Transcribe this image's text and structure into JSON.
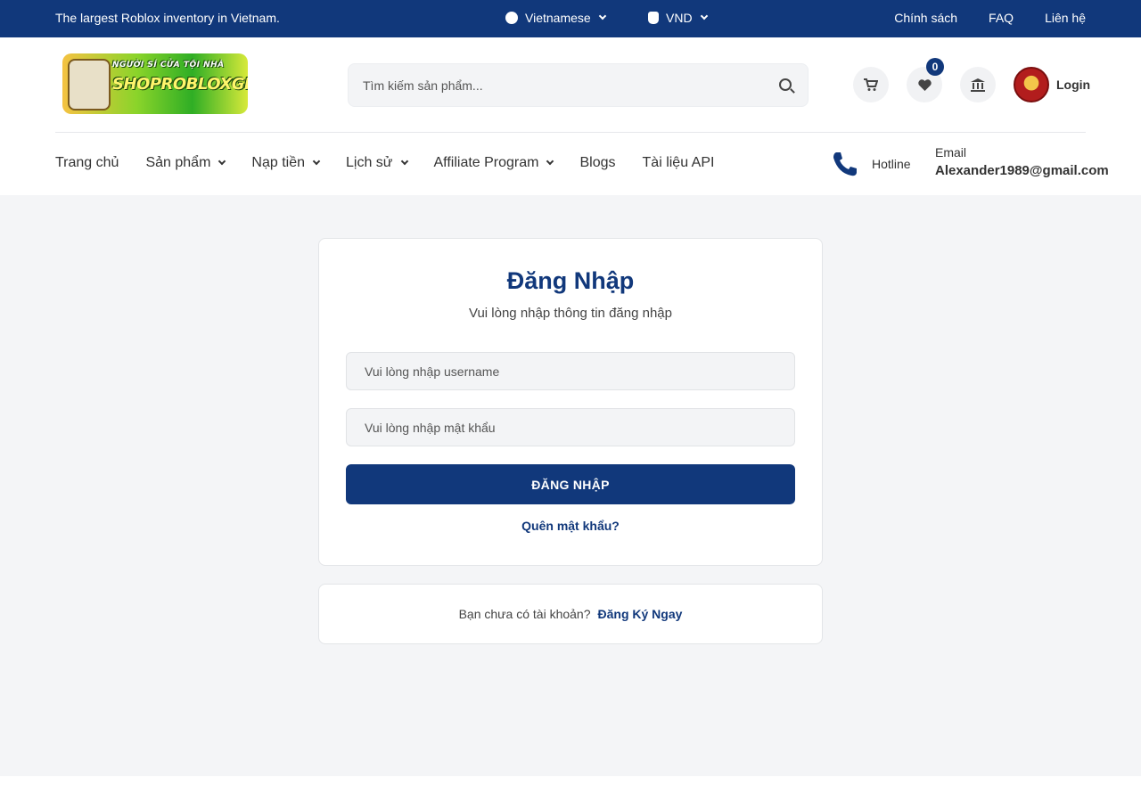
{
  "topbar": {
    "tagline": "The largest Roblox inventory in Vietnam.",
    "language": "Vietnamese",
    "currency": "VND",
    "links": [
      "Chính sách",
      "FAQ",
      "Liên hệ"
    ]
  },
  "header": {
    "logo_text_small": "NGƯỜI SÍ CỬA TỘI NHÀ",
    "logo_text_big": "SHOPROBLOXGIASI",
    "search_placeholder": "Tìm kiếm sản phẩm...",
    "wishlist_count": "0",
    "login_label": "Login",
    "icons": [
      "cart-icon",
      "heart-icon",
      "bank-icon"
    ]
  },
  "nav": {
    "items": [
      {
        "label": "Trang chủ",
        "dropdown": false
      },
      {
        "label": "Sản phẩm",
        "dropdown": true
      },
      {
        "label": "Nạp tiền",
        "dropdown": true
      },
      {
        "label": "Lịch sử",
        "dropdown": true
      },
      {
        "label": "Affiliate Program",
        "dropdown": true
      },
      {
        "label": "Blogs",
        "dropdown": false
      },
      {
        "label": "Tài liệu API",
        "dropdown": false
      }
    ],
    "hotline_label": "Hotline",
    "email_label": "Email",
    "email_value": "Alexander1989@gmail.com"
  },
  "login": {
    "title": "Đăng Nhập",
    "subtitle": "Vui lòng nhập thông tin đăng nhập",
    "username_placeholder": "Vui lòng nhập username",
    "password_placeholder": "Vui lòng nhập mật khẩu",
    "submit_label": "ĐĂNG NHẬP",
    "forgot_label": "Quên mật khẩu?"
  },
  "register": {
    "question": "Bạn chưa có tài khoản?",
    "link_label": "Đăng Ký Ngay"
  },
  "colors": {
    "brand": "#11387b",
    "page_bg": "#f4f5f7"
  }
}
